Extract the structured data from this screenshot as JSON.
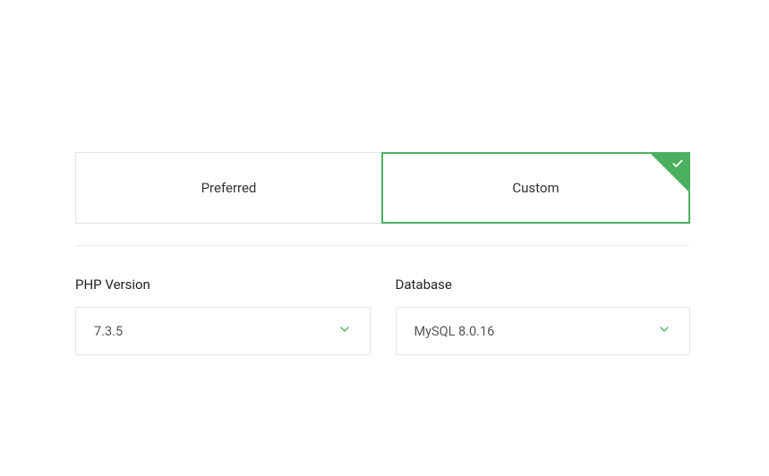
{
  "tabs": {
    "preferred_label": "Preferred",
    "custom_label": "Custom"
  },
  "php": {
    "label": "PHP Version",
    "value": "7.3.5"
  },
  "database": {
    "label": "Database",
    "value": "MySQL 8.0.16"
  }
}
